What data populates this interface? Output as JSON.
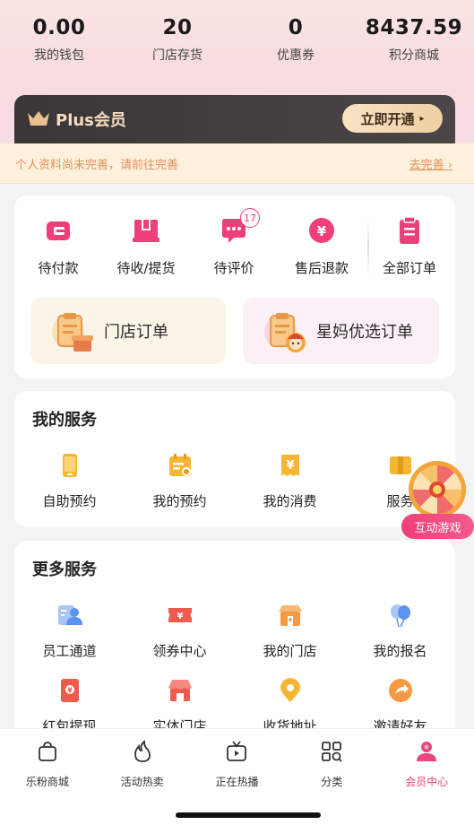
{
  "stats": [
    {
      "value": "0.00",
      "label": "我的钱包"
    },
    {
      "value": "20",
      "label": "门店存货"
    },
    {
      "value": "0",
      "label": "优惠券"
    },
    {
      "value": "8437.59",
      "label": "积分商城"
    }
  ],
  "plus": {
    "title": "Plus会员",
    "button": "立即开通",
    "button_arrow": "▸"
  },
  "notice": {
    "text": "个人资料尚未完善，请前往完善",
    "link": "去完善 ›"
  },
  "orders": {
    "items": [
      {
        "label": "待付款",
        "icon": "wallet-icon"
      },
      {
        "label": "待收/提货",
        "icon": "box-icon"
      },
      {
        "label": "待评价",
        "icon": "comment-icon",
        "badge": "17"
      },
      {
        "label": "售后退款",
        "icon": "refund-icon"
      },
      {
        "label": "全部订单",
        "icon": "clipboard-icon"
      }
    ],
    "store_order": "门店订单",
    "mall_order": "星妈优选订单"
  },
  "my_services": {
    "title": "我的服务",
    "items": [
      {
        "label": "自助预约",
        "icon": "phone-icon"
      },
      {
        "label": "我的预约",
        "icon": "calendar-icon"
      },
      {
        "label": "我的消费",
        "icon": "yen-receipt-icon"
      },
      {
        "label": "服务",
        "icon": "ticket-icon"
      }
    ]
  },
  "more_services": {
    "title": "更多服务",
    "items": [
      {
        "label": "员工通道",
        "icon": "staff-icon"
      },
      {
        "label": "领券中心",
        "icon": "coupon-icon"
      },
      {
        "label": "我的门店",
        "icon": "store-icon"
      },
      {
        "label": "我的报名",
        "icon": "balloon-icon"
      },
      {
        "label": "红包提现",
        "icon": "red-packet-icon"
      },
      {
        "label": "实体门店",
        "icon": "shop-awning-icon"
      },
      {
        "label": "收货地址",
        "icon": "location-icon"
      },
      {
        "label": "邀请好友",
        "icon": "share-icon"
      }
    ]
  },
  "game": {
    "label": "互动游戏"
  },
  "tabbar": [
    {
      "label": "乐粉商城",
      "icon": "bag-icon"
    },
    {
      "label": "活动热卖",
      "icon": "flame-icon"
    },
    {
      "label": "正在热播",
      "icon": "tv-icon"
    },
    {
      "label": "分类",
      "icon": "grid-icon"
    },
    {
      "label": "会员中心",
      "icon": "member-icon",
      "active": true
    }
  ],
  "colors": {
    "accent": "#e8467d",
    "gold": "#f5dcc0",
    "notice": "#e4915a"
  }
}
